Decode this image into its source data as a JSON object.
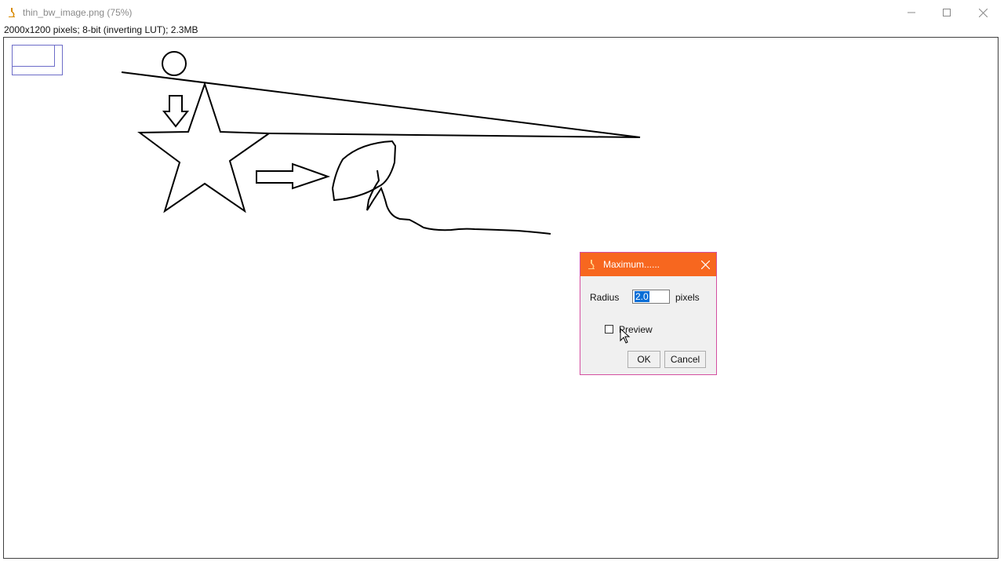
{
  "window": {
    "title": "thin_bw_image.png (75%)",
    "info": "2000x1200 pixels; 8-bit (inverting LUT); 2.3MB",
    "icons": [
      "microscope-icon",
      "minimize-icon",
      "maximize-icon",
      "close-icon"
    ]
  },
  "dialog": {
    "title": "Maximum......",
    "radius_label": "Radius",
    "radius_value": "2.0",
    "units_label": "pixels",
    "preview_label": "Preview",
    "preview_checked": false,
    "ok_label": "OK",
    "cancel_label": "Cancel",
    "title_color": "#f7671f"
  }
}
